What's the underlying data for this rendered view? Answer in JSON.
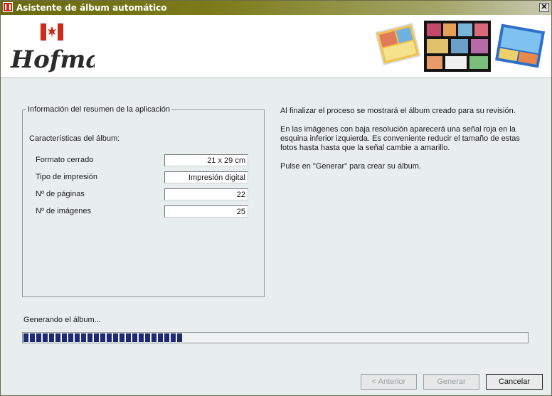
{
  "window": {
    "title": "Asistente de álbum automático",
    "close_label": "✕"
  },
  "brand": {
    "logo_text": "Hofmann"
  },
  "summary": {
    "legend": "Información del resumen de la aplicación",
    "section": "Características del álbum:",
    "rows": [
      {
        "label": "Formato cerrado",
        "value": "21 x 29 cm"
      },
      {
        "label": "Tipo de impresión",
        "value": "Impresión digital"
      },
      {
        "label": "Nº de páginas",
        "value": "22"
      },
      {
        "label": "Nº de imágenes",
        "value": "25"
      }
    ]
  },
  "description": {
    "line1": "Al finalizar el proceso se mostrará el álbum creado para su revisión.",
    "line2": "En las imágenes con baja resolución aparecerá una señal roja en la esquina inferior izquierda. Es conveniente reducir el tamaño de estas fotos hasta hasta que la señal cambie a amarillo.",
    "line3": "Pulse en \"Generar\" para crear su álbum."
  },
  "status": {
    "text": "Generando el álbum...",
    "progress": 0.32
  },
  "buttons": {
    "prev": "< Anterior",
    "generate": "Generar",
    "cancel": "Cancelar"
  },
  "colors": {
    "brand_red": "#cc2a1a",
    "progress_blue": "#1e2a73",
    "title_olive": "#6a6a0e"
  }
}
